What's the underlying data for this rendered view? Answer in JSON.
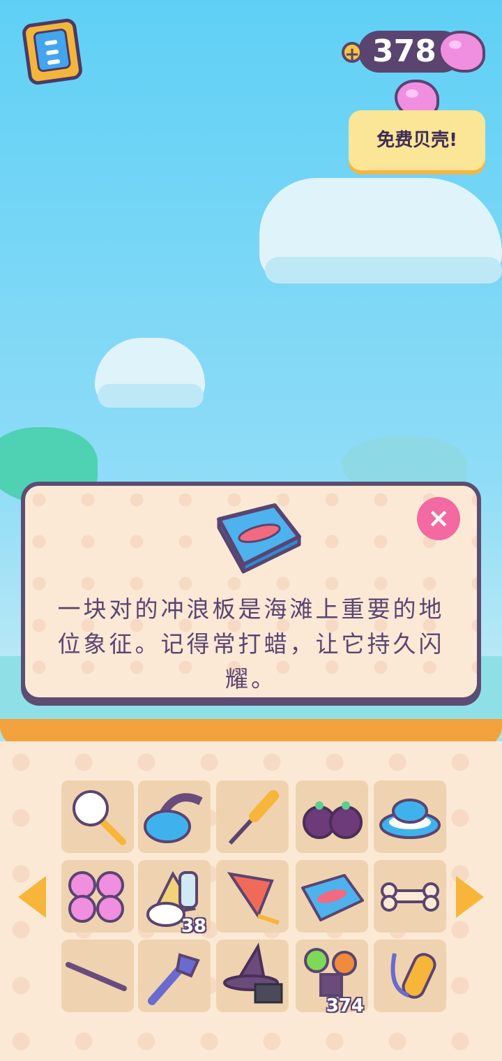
{
  "hud": {
    "shell_count": "378",
    "plus_label": "+",
    "free_shells_label": "免费贝壳!"
  },
  "dialog": {
    "description": "一块对的冲浪板是海滩上重要的地位象征。记得常打蜡，让它持久闪耀。",
    "close_label": "×",
    "item_icon": "surfboard-box-icon"
  },
  "inventory": {
    "rows": [
      [
        {
          "icon": "feather-duster-icon",
          "count": ""
        },
        {
          "icon": "swim-goggles-icon",
          "count": ""
        },
        {
          "icon": "screwdriver-icon",
          "count": ""
        },
        {
          "icon": "berries-icon",
          "count": ""
        },
        {
          "icon": "striped-rope-icon",
          "count": ""
        }
      ],
      [
        {
          "icon": "shell-coins-icon",
          "count": ""
        },
        {
          "icon": "trash-pile-icon",
          "count": "38"
        },
        {
          "icon": "kite-icon",
          "count": ""
        },
        {
          "icon": "surfboard-box-icon",
          "count": ""
        },
        {
          "icon": "bone-icon",
          "count": ""
        }
      ],
      [
        {
          "icon": "fishing-rod-icon",
          "count": ""
        },
        {
          "icon": "fork-icon",
          "count": ""
        },
        {
          "icon": "witch-hat-icon",
          "count": ""
        },
        {
          "icon": "candy-pile-icon",
          "count": "374"
        },
        {
          "icon": "surf-leash-icon",
          "count": ""
        }
      ]
    ]
  },
  "colors": {
    "accent_orange": "#f7b53a",
    "text_purple": "#5a4470",
    "close_pink": "#f26aa1"
  }
}
